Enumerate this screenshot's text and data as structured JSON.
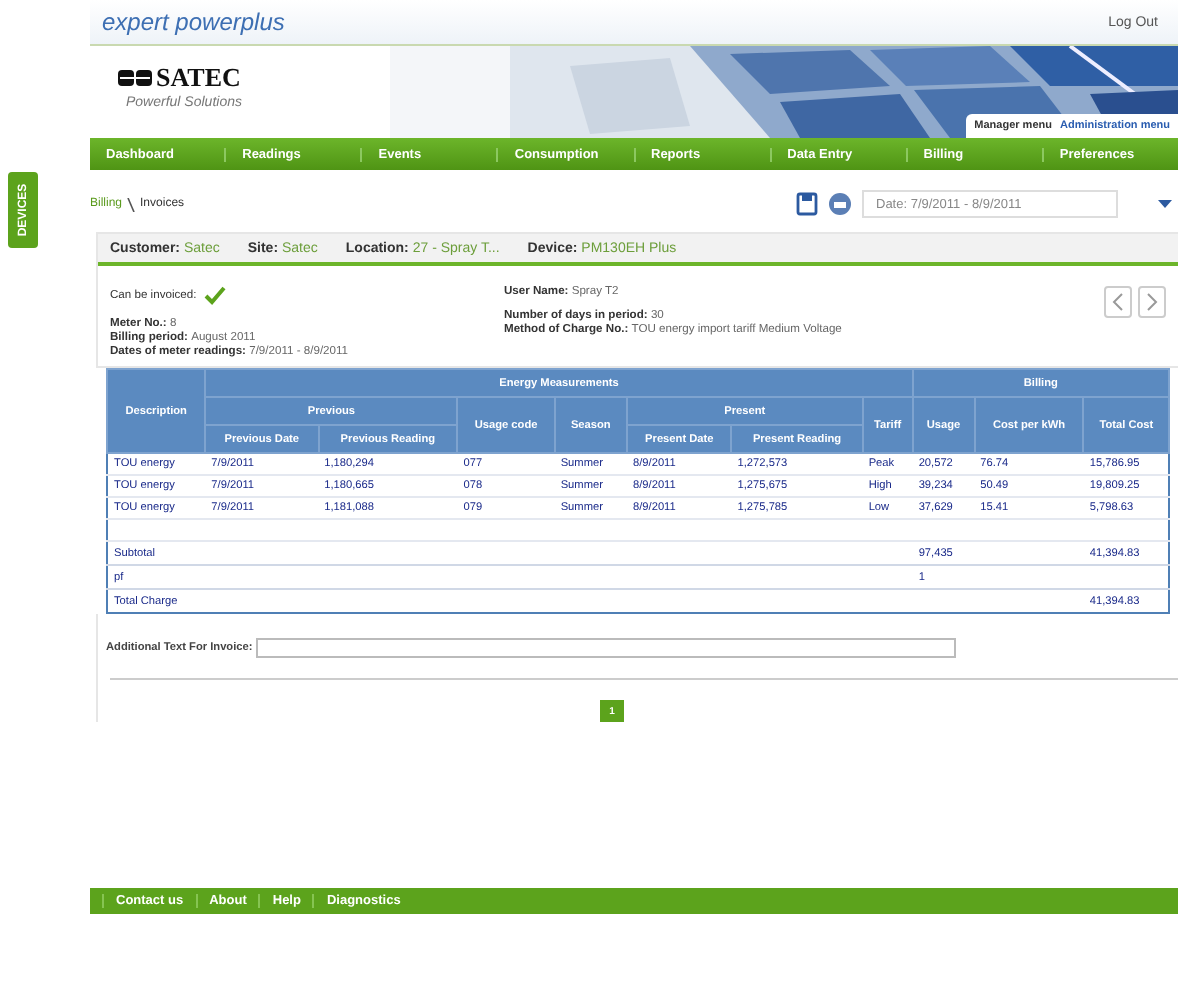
{
  "brand": {
    "product": "expert powerplus"
  },
  "logout": "Log Out",
  "logo": {
    "name": "SATEC",
    "tagline": "Powerful Solutions"
  },
  "banner_menu": [
    {
      "label": "Manager menu",
      "selected": true
    },
    {
      "label": "Administration menu",
      "selected": false
    }
  ],
  "nav": [
    {
      "label": "Dashboard"
    },
    {
      "label": "Readings"
    },
    {
      "label": "Events"
    },
    {
      "label": "Consumption"
    },
    {
      "label": "Reports"
    },
    {
      "label": "Data Entry"
    },
    {
      "label": "Billing"
    },
    {
      "label": "Preferences"
    }
  ],
  "side_tab": "DEVICES",
  "breadcrumb": [
    "Billing",
    "Invoices"
  ],
  "date_range": "Date: 7/9/2011 - 8/9/2011",
  "header_fields": [
    {
      "label": "Customer:",
      "value": "Satec"
    },
    {
      "label": "Site:",
      "value": "Satec"
    },
    {
      "label": "Location:",
      "value": "27 - Spray T..."
    },
    {
      "label": "Device:",
      "value": "PM130EH Plus"
    }
  ],
  "invoiceable": {
    "label": "Can be invoiced:",
    "checked": true
  },
  "details_left": [
    {
      "label": "Meter No.:",
      "value": "8"
    },
    {
      "label": "Billing period:",
      "value": "August 2011"
    },
    {
      "label": "Dates of meter readings:",
      "value": "7/9/2011 - 8/9/2011"
    }
  ],
  "details_right": [
    {
      "label": "User Name:",
      "value": "Spray T2"
    },
    {
      "label": "Number of days in period:",
      "value": "30"
    },
    {
      "label": "Method of Charge No.:",
      "value": "TOU energy import tariff Medium Voltage"
    }
  ],
  "table": {
    "groups": [
      "Energy Measurements",
      "Billing"
    ],
    "subgroups": [
      "Previous",
      "Present"
    ],
    "columns": [
      "Description",
      "Previous Date",
      "Previous Reading",
      "Usage code",
      "Season",
      "Present Date",
      "Present Reading",
      "Tariff",
      "Usage",
      "Cost per kWh",
      "Total Cost"
    ],
    "rows": [
      {
        "cells": [
          "TOU energy",
          "7/9/2011",
          "1,180,294",
          "077",
          "Summer",
          "8/9/2011",
          "1,272,573",
          "Peak",
          "20,572",
          "76.74",
          "15,786.95"
        ]
      },
      {
        "cells": [
          "TOU energy",
          "7/9/2011",
          "1,180,665",
          "078",
          "Summer",
          "8/9/2011",
          "1,275,675",
          "High",
          "39,234",
          "50.49",
          "19,809.25"
        ]
      },
      {
        "cells": [
          "TOU energy",
          "7/9/2011",
          "1,181,088",
          "079",
          "Summer",
          "8/9/2011",
          "1,275,785",
          "Low",
          "37,629",
          "15.41",
          "5,798.63"
        ]
      }
    ],
    "summary": [
      {
        "label": "Subtotal",
        "usage": "97,435",
        "total_cost": "41,394.83"
      },
      {
        "label": "pf",
        "usage": "1"
      },
      {
        "label": "Total Charge",
        "total_cost": "41,394.83"
      }
    ]
  },
  "additional_text": {
    "label": "Additional Text For Invoice:"
  },
  "pagination": [
    {
      "label": "1",
      "selected": true
    }
  ],
  "footer": [
    "Contact us",
    "About",
    "Help",
    "Diagnostics"
  ]
}
